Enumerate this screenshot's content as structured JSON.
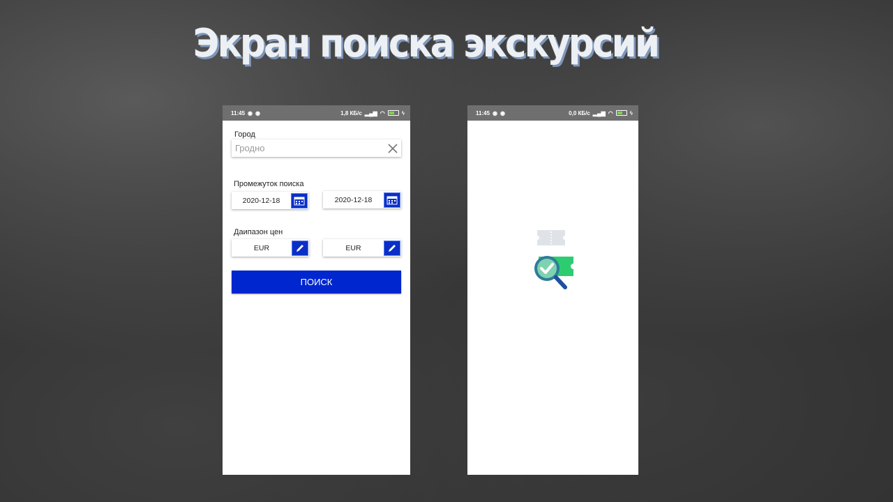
{
  "slide": {
    "title": "Экран поиска экскурсий"
  },
  "left_phone": {
    "status": {
      "time": "11:45",
      "speed": "1,8 КБ/с"
    },
    "city": {
      "label": "Город",
      "placeholder": "Гродно"
    },
    "period": {
      "label": "Промежуток поиска",
      "from": "2020-12-18",
      "to": "2020-12-18"
    },
    "price": {
      "label": "Даипазон цен",
      "min": "EUR",
      "max": "EUR"
    },
    "search_button": "ПОИСК"
  },
  "right_phone": {
    "status": {
      "time": "11:45",
      "speed": "0,0 КБ/с"
    }
  },
  "colors": {
    "accent": "#0026cf",
    "statusbar": "#6f6f6f",
    "check": "#2ecc71",
    "magnifier": "#1f4fa0"
  },
  "icons": [
    "calendar-icon",
    "pencil-icon",
    "close-icon",
    "ticket-icon",
    "magnifier-check-icon"
  ]
}
